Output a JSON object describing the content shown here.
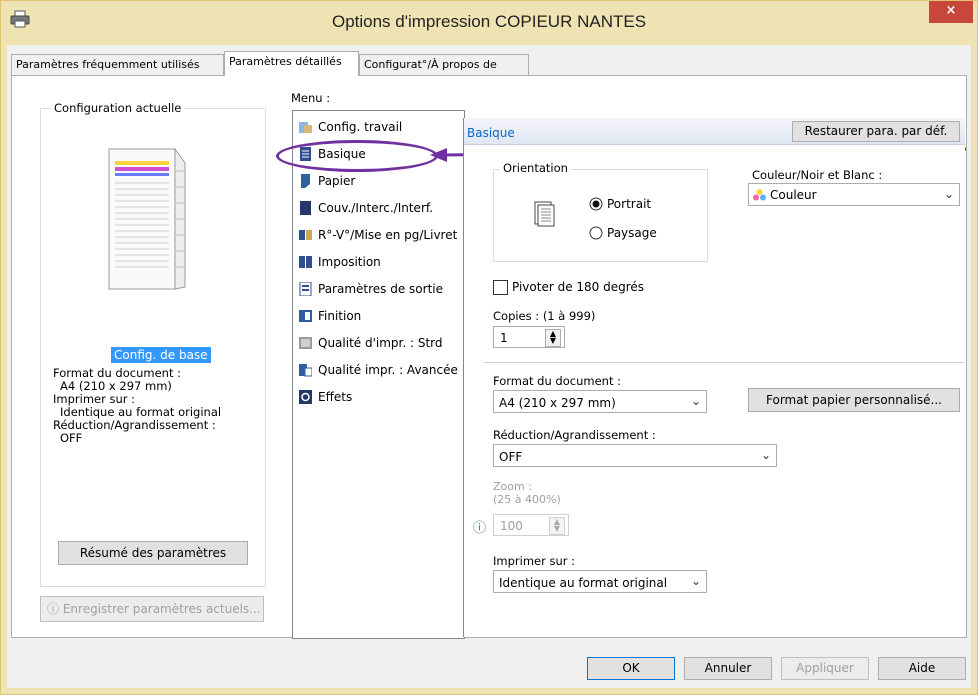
{
  "window": {
    "title": "Options d'impression COPIEUR NANTES",
    "close_glyph": "×",
    "icon": "printer-icon"
  },
  "tabs": [
    {
      "label": "Paramètres fréquemment utilisés",
      "active": false
    },
    {
      "label": "Paramètres détaillés",
      "active": true
    },
    {
      "label": "Configurat°/À propos de",
      "active": false
    }
  ],
  "left_panel": {
    "group_label": "Configuration actuelle",
    "config_link": "Config. de base",
    "summary": [
      "Format du document :",
      "A4 (210 x 297 mm)",
      "Imprimer sur :",
      "Identique au format original",
      "Réduction/Agrandissement :",
      "OFF"
    ],
    "summary_button": "Résumé des paramètres",
    "save_button": "Enregistrer paramètres actuels..."
  },
  "menu": {
    "label": "Menu :",
    "items": [
      {
        "label": "Config. travail",
        "icon": "job-config-icon"
      },
      {
        "label": "Basique",
        "icon": "basic-icon"
      },
      {
        "label": "Papier",
        "icon": "paper-icon"
      },
      {
        "label": "Couv./Interc./Interf.",
        "icon": "cover-icon"
      },
      {
        "label": "R°-V°/Mise en pg/Livret",
        "icon": "duplex-icon"
      },
      {
        "label": "Imposition",
        "icon": "imposition-icon"
      },
      {
        "label": "Paramètres de sortie",
        "icon": "output-icon"
      },
      {
        "label": "Finition",
        "icon": "finishing-icon"
      },
      {
        "label": "Qualité d'impr. : Strd",
        "icon": "quality-icon"
      },
      {
        "label": "Qualité impr. : Avancée",
        "icon": "quality-advanced-icon"
      },
      {
        "label": "Effets",
        "icon": "effects-icon"
      }
    ]
  },
  "basic": {
    "header": "Basique",
    "restore_button": "Restaurer para. par déf.",
    "orientation": {
      "label": "Orientation",
      "portrait": "Portrait",
      "landscape": "Paysage",
      "selected": "Portrait"
    },
    "color": {
      "label": "Couleur/Noir et Blanc :",
      "value": "Couleur"
    },
    "rotate": {
      "label": "Pivoter de 180 degrés",
      "checked": false
    },
    "copies": {
      "label": "Copies : (1 à 999)",
      "value": "1"
    },
    "doc_format": {
      "label": "Format du document :",
      "value": "A4 (210 x 297 mm)"
    },
    "custom_paper_button": "Format papier personnalisé...",
    "reduction": {
      "label": "Réduction/Agrandissement :",
      "value": "OFF"
    },
    "zoom": {
      "label": "Zoom :",
      "range": "(25 à 400%)",
      "value": "100"
    },
    "print_on": {
      "label": "Imprimer sur :",
      "value": "Identique au format original"
    }
  },
  "footer": {
    "ok": "OK",
    "cancel": "Annuler",
    "apply": "Appliquer",
    "help": "Aide"
  },
  "colors": {
    "frame": "#f0e3b3",
    "close": "#c7483b",
    "accent": "#0066cc",
    "annotation": "#7030a0"
  }
}
